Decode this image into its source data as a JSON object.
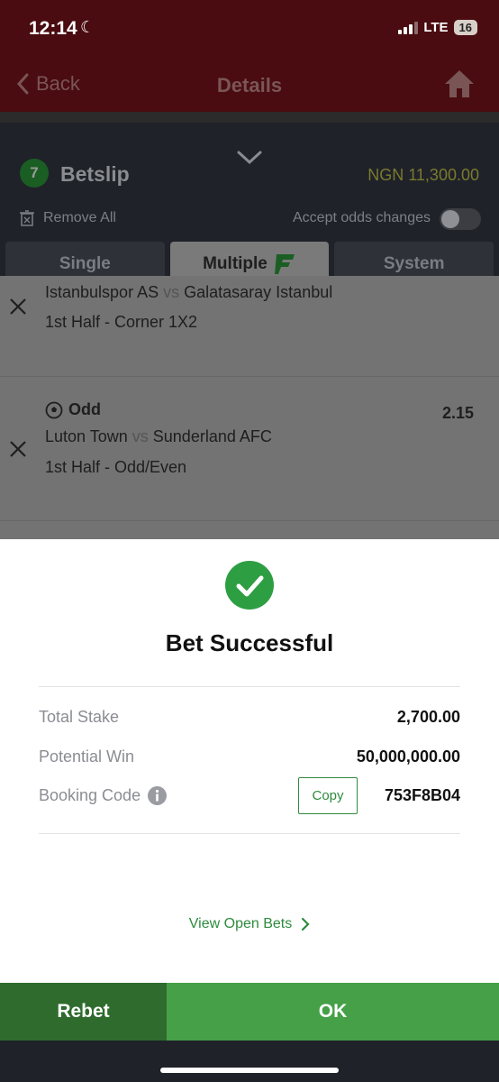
{
  "status": {
    "time": "12:14",
    "network": "LTE",
    "battery": "16"
  },
  "header": {
    "back_label": "Back",
    "title": "Details"
  },
  "betslip": {
    "count": "7",
    "title": "Betslip",
    "total": "NGN 11,300.00",
    "remove_all": "Remove All",
    "accept_odds": "Accept odds changes",
    "tabs": [
      {
        "label": "Single"
      },
      {
        "label": "Multiple"
      },
      {
        "label": "System"
      }
    ]
  },
  "bets": [
    {
      "home": "Istanbulspor AS",
      "vs": "vs",
      "away": "Galatasaray Istanbul",
      "market": "1st Half - Corner 1X2"
    },
    {
      "selection": "Odd",
      "odds": "2.15",
      "home": "Luton Town",
      "vs": "vs",
      "away": "Sunderland AFC",
      "market": "1st Half - Odd/Even"
    }
  ],
  "success": {
    "title": "Bet Successful",
    "total_stake_label": "Total Stake",
    "total_stake": "2,700.00",
    "potential_win_label": "Potential Win",
    "potential_win": "50,000,000.00",
    "booking_code_label": "Booking Code",
    "copy_label": "Copy",
    "booking_code": "753F8B04",
    "view_open_bets": "View Open Bets"
  },
  "actions": {
    "rebet": "Rebet",
    "ok": "OK"
  },
  "colors": {
    "accent_green": "#45a047",
    "dark_green": "#2e6b2d",
    "brand_red": "#8b1a1f"
  }
}
